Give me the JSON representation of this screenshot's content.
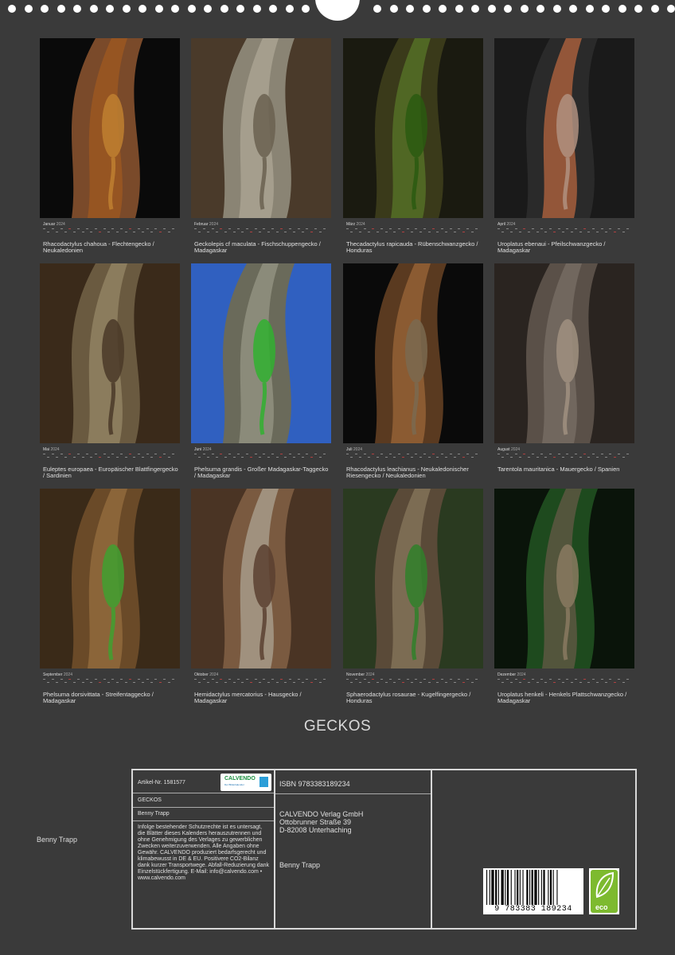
{
  "months": [
    {
      "name": "Januar",
      "year": "2024",
      "caption": "Rhacodactylus chahoua - Flechtengecko / Neukaledonien"
    },
    {
      "name": "Februar",
      "year": "2024",
      "caption": "Geckolepis cf maculata - Fischschuppengecko / Madagaskar"
    },
    {
      "name": "März",
      "year": "2024",
      "caption": "Thecadactylus rapicauda - Rübenschwanzgecko / Honduras"
    },
    {
      "name": "April",
      "year": "2024",
      "caption": "Uroplatus ebenaui - Pfeilschwanzgecko / Madagaskar"
    },
    {
      "name": "Mai",
      "year": "2024",
      "caption": "Euleptes europaea - Europäischer Blattfingergecko / Sardinien"
    },
    {
      "name": "Juni",
      "year": "2024",
      "caption": "Phelsuma grandis - Großer Madagaskar-Taggecko / Madagaskar"
    },
    {
      "name": "Juli",
      "year": "2024",
      "caption": "Rhacodactylus leachianus - Neukaledonischer Riesengecko / Neukaledonien"
    },
    {
      "name": "August",
      "year": "2024",
      "caption": "Tarentola mauritanica - Mauergecko / Spanien"
    },
    {
      "name": "September",
      "year": "2024",
      "caption": "Phelsuma dorsivittata - Streifentaggecko / Madagaskar"
    },
    {
      "name": "Oktober",
      "year": "2024",
      "caption": "Hemidactylus mercatorius - Hausgecko / Madagaskar"
    },
    {
      "name": "November",
      "year": "2024",
      "caption": "Sphaerodactylus rosaurae - Kugelfingergecko / Honduras"
    },
    {
      "name": "Dezember",
      "year": "2024",
      "caption": "Uroplatus henkeli - Henkels Plattschwanzgecko / Madagaskar"
    }
  ],
  "title": "GECKOS",
  "author": "Benny Trapp",
  "info": {
    "article": "Artikel-Nr. 1581577",
    "logo_text": "CALVENDO",
    "logo_sub": "Der Bilderkalender",
    "product_title": "GECKOS",
    "product_author": "Benny Trapp",
    "legal": "Infolge bestehender Schutzrechte ist es untersagt, die Blätter dieses Kalenders herauszutrennen und ohne Genehmigung des Verlages zu gewerblichen Zwecken weiterzuverwenden. Alle Angaben ohne Gewähr. CALVENDO produziert bedarfsgerecht und klimabewusst in DE & EU. Positivere CO2-Bilanz dank kurzer Transportwege. Abfall-Reduzierung dank Einzelstückfertigung. E-Mail: info@calvendo.com • www.calvendo.com",
    "isbn": "ISBN 9783383189234",
    "publisher_line1": "CALVENDO Verlag GmbH",
    "publisher_line2": "Ottobrunner Straße 39",
    "publisher_line3": "D-82008 Unterhaching",
    "publisher_author": "Benny Trapp",
    "barcode_digits": "9 783383 189234",
    "eco_label": "eco"
  },
  "colors": {
    "background": "#3a3a3a",
    "text": "#e0e0e0",
    "frame": "#d8d8d8",
    "eco_green": "#7dba2f"
  }
}
